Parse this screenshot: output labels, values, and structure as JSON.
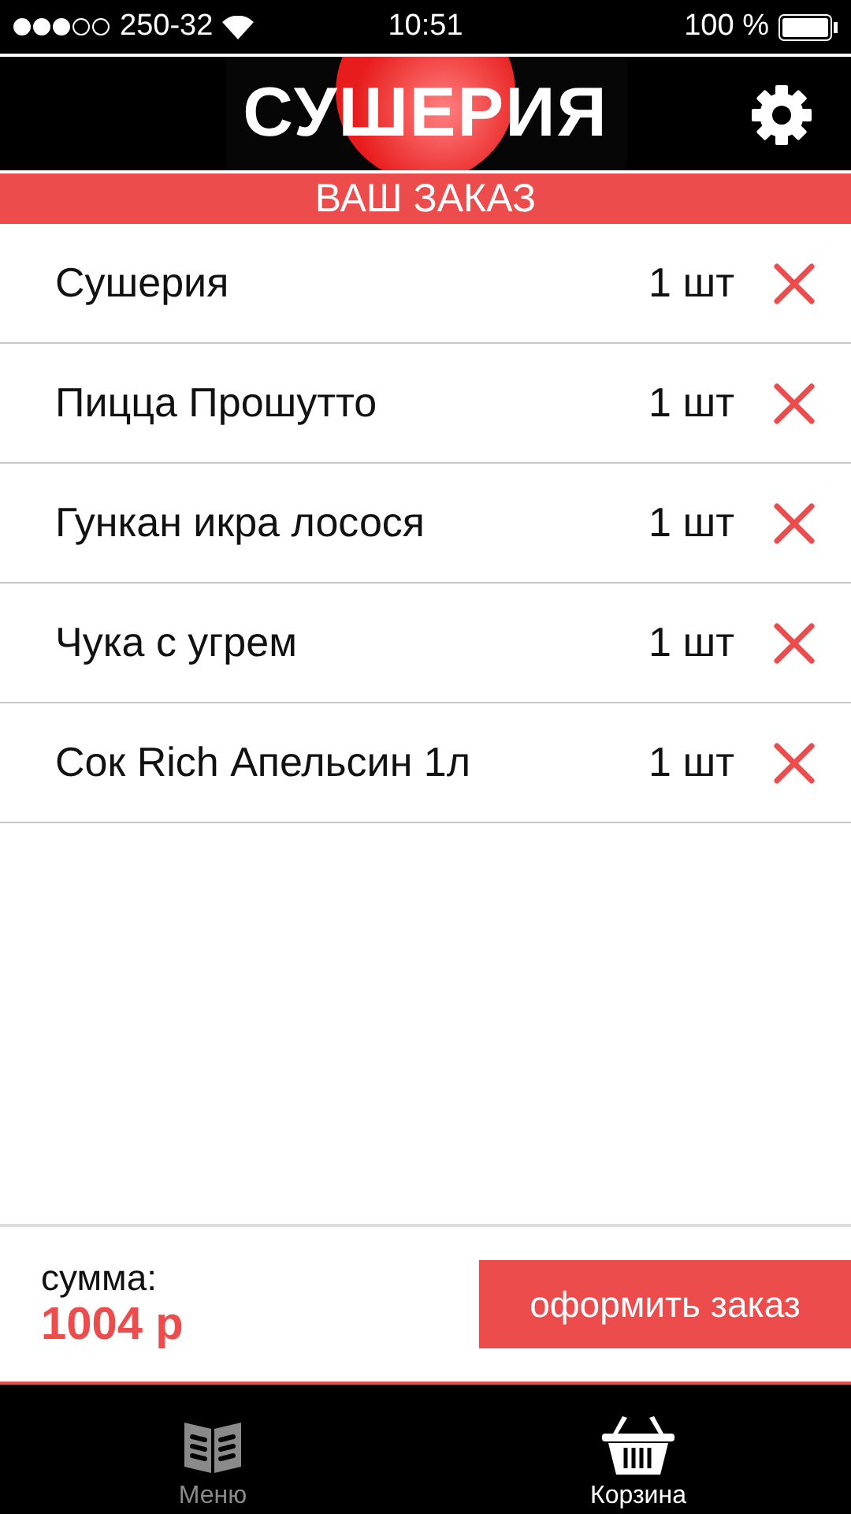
{
  "status_bar": {
    "carrier": "250-32",
    "time": "10:51",
    "battery": "100 %"
  },
  "header": {
    "logo": "СУШЕРИЯ"
  },
  "section_title": "ВАШ ЗАКАЗ",
  "items": [
    {
      "name": "Сушерия",
      "qty": "1 шт"
    },
    {
      "name": "Пицца Прошутто",
      "qty": "1 шт"
    },
    {
      "name": "Гункан икра лосося",
      "qty": "1 шт"
    },
    {
      "name": "Чука с угрем",
      "qty": "1 шт"
    },
    {
      "name": "Сок Rich Апельсин 1л",
      "qty": "1 шт"
    }
  ],
  "total": {
    "label": "сумма:",
    "value": "1004 р"
  },
  "checkout_button": "оформить заказ",
  "tabs": [
    {
      "label": "Меню",
      "kind": "menu",
      "selected": false
    },
    {
      "label": "Корзина",
      "kind": "cart",
      "selected": true
    }
  ]
}
